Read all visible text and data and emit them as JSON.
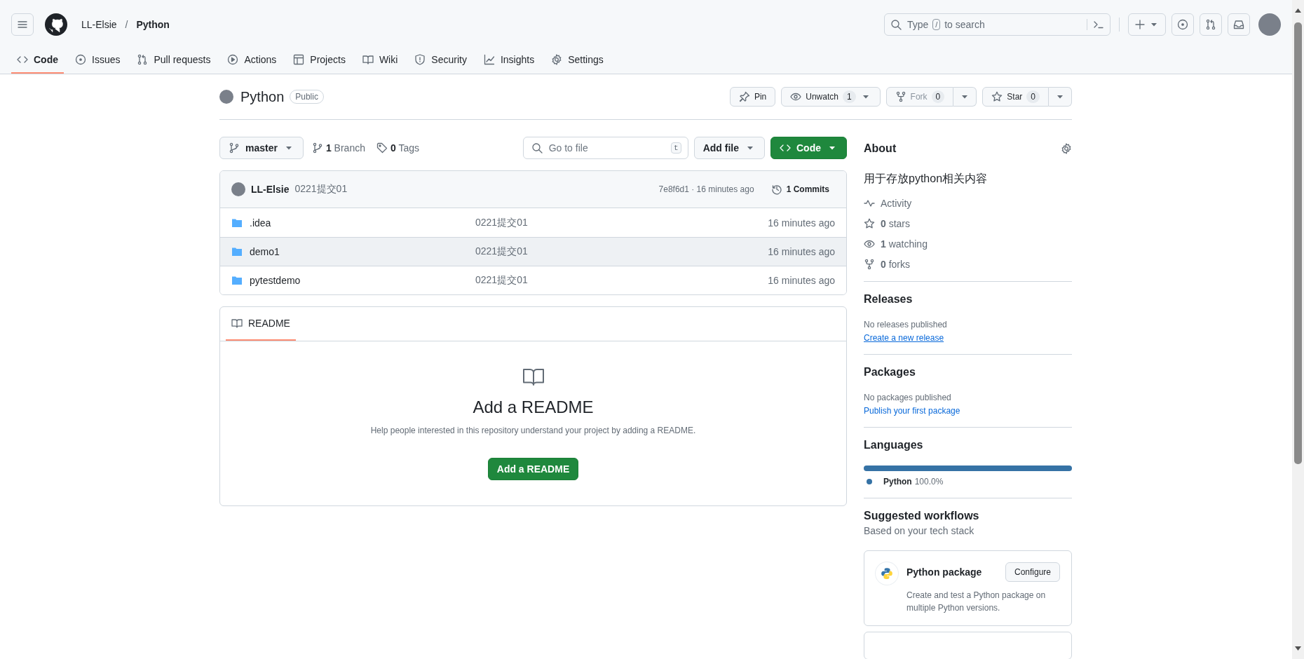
{
  "header": {
    "owner": "LL-Elsie",
    "separator": "/",
    "repo": "Python",
    "search": {
      "prefix": "Type",
      "key": "/",
      "suffix": "to search"
    }
  },
  "tabs": [
    {
      "kind": "code",
      "label": "Code",
      "selected": true
    },
    {
      "kind": "issues",
      "label": "Issues",
      "selected": false
    },
    {
      "kind": "pulls",
      "label": "Pull requests",
      "selected": false
    },
    {
      "kind": "actions",
      "label": "Actions",
      "selected": false
    },
    {
      "kind": "projects",
      "label": "Projects",
      "selected": false
    },
    {
      "kind": "wiki",
      "label": "Wiki",
      "selected": false
    },
    {
      "kind": "security",
      "label": "Security",
      "selected": false
    },
    {
      "kind": "insights",
      "label": "Insights",
      "selected": false
    },
    {
      "kind": "settings",
      "label": "Settings",
      "selected": false
    }
  ],
  "repo": {
    "name": "Python",
    "visibility": "Public",
    "actions": [
      {
        "kind": "pin",
        "label": "Pin",
        "split": false,
        "disabled": false
      },
      {
        "kind": "watch",
        "label": "Unwatch",
        "count": "1",
        "dropdown": true,
        "split": false,
        "disabled": false
      },
      {
        "kind": "fork",
        "label": "Fork",
        "count": "0",
        "dropdown": true,
        "split": true,
        "disabled": true
      },
      {
        "kind": "star",
        "label": "Star",
        "count": "0",
        "dropdown": true,
        "split": true,
        "disabled": false
      }
    ]
  },
  "toolbar": {
    "branch": "master",
    "branches": "**1** Branch",
    "tags": "**0** Tags",
    "go_to_file": {
      "placeholder": "Go to file",
      "key": "t"
    },
    "add_file": "Add file",
    "code": "Code"
  },
  "commit": {
    "author": "LL-Elsie",
    "message": "0221提交01",
    "meta": "7e8f6d1 · 16 minutes ago",
    "commits": "1 Commits"
  },
  "files": [
    {
      "kind": "folder",
      "name": ".idea",
      "message": "0221提交01",
      "time": "16 minutes ago",
      "hovered": false
    },
    {
      "kind": "folder",
      "name": "demo1",
      "message": "0221提交01",
      "time": "16 minutes ago",
      "hovered": true
    },
    {
      "kind": "folder",
      "name": "pytestdemo",
      "message": "0221提交01",
      "time": "16 minutes ago",
      "hovered": false
    }
  ],
  "readme": {
    "tab": "README",
    "tab_selected": true,
    "title": "Add a README",
    "text": "Help people interested in this repository understand your project by adding a README.",
    "button": "Add a README"
  },
  "sidebar": {
    "about": {
      "title": "About",
      "description": "用于存放python相关内容",
      "stats": [
        {
          "kind": "activity",
          "label": "Activity"
        },
        {
          "kind": "star",
          "label": "**0** stars"
        },
        {
          "kind": "watch",
          "label": "**1** watching"
        },
        {
          "kind": "fork",
          "label": "**0** forks"
        }
      ]
    },
    "releases": {
      "title": "Releases",
      "text": "No releases published",
      "link": "Create a new release"
    },
    "packages": {
      "title": "Packages",
      "text": "No packages published",
      "link": "Publish your first package"
    },
    "languages": {
      "title": "Languages",
      "items": [
        {
          "name": "Python",
          "percent": "100.0%",
          "color": "#3572a5",
          "level": 1
        }
      ]
    },
    "workflows": {
      "title": "Suggested workflows",
      "subtitle": "Based on your tech stack",
      "cards": [
        {
          "title": "Python package",
          "description": "Create and test a Python package on multiple Python versions.",
          "button": "Configure"
        }
      ]
    }
  }
}
